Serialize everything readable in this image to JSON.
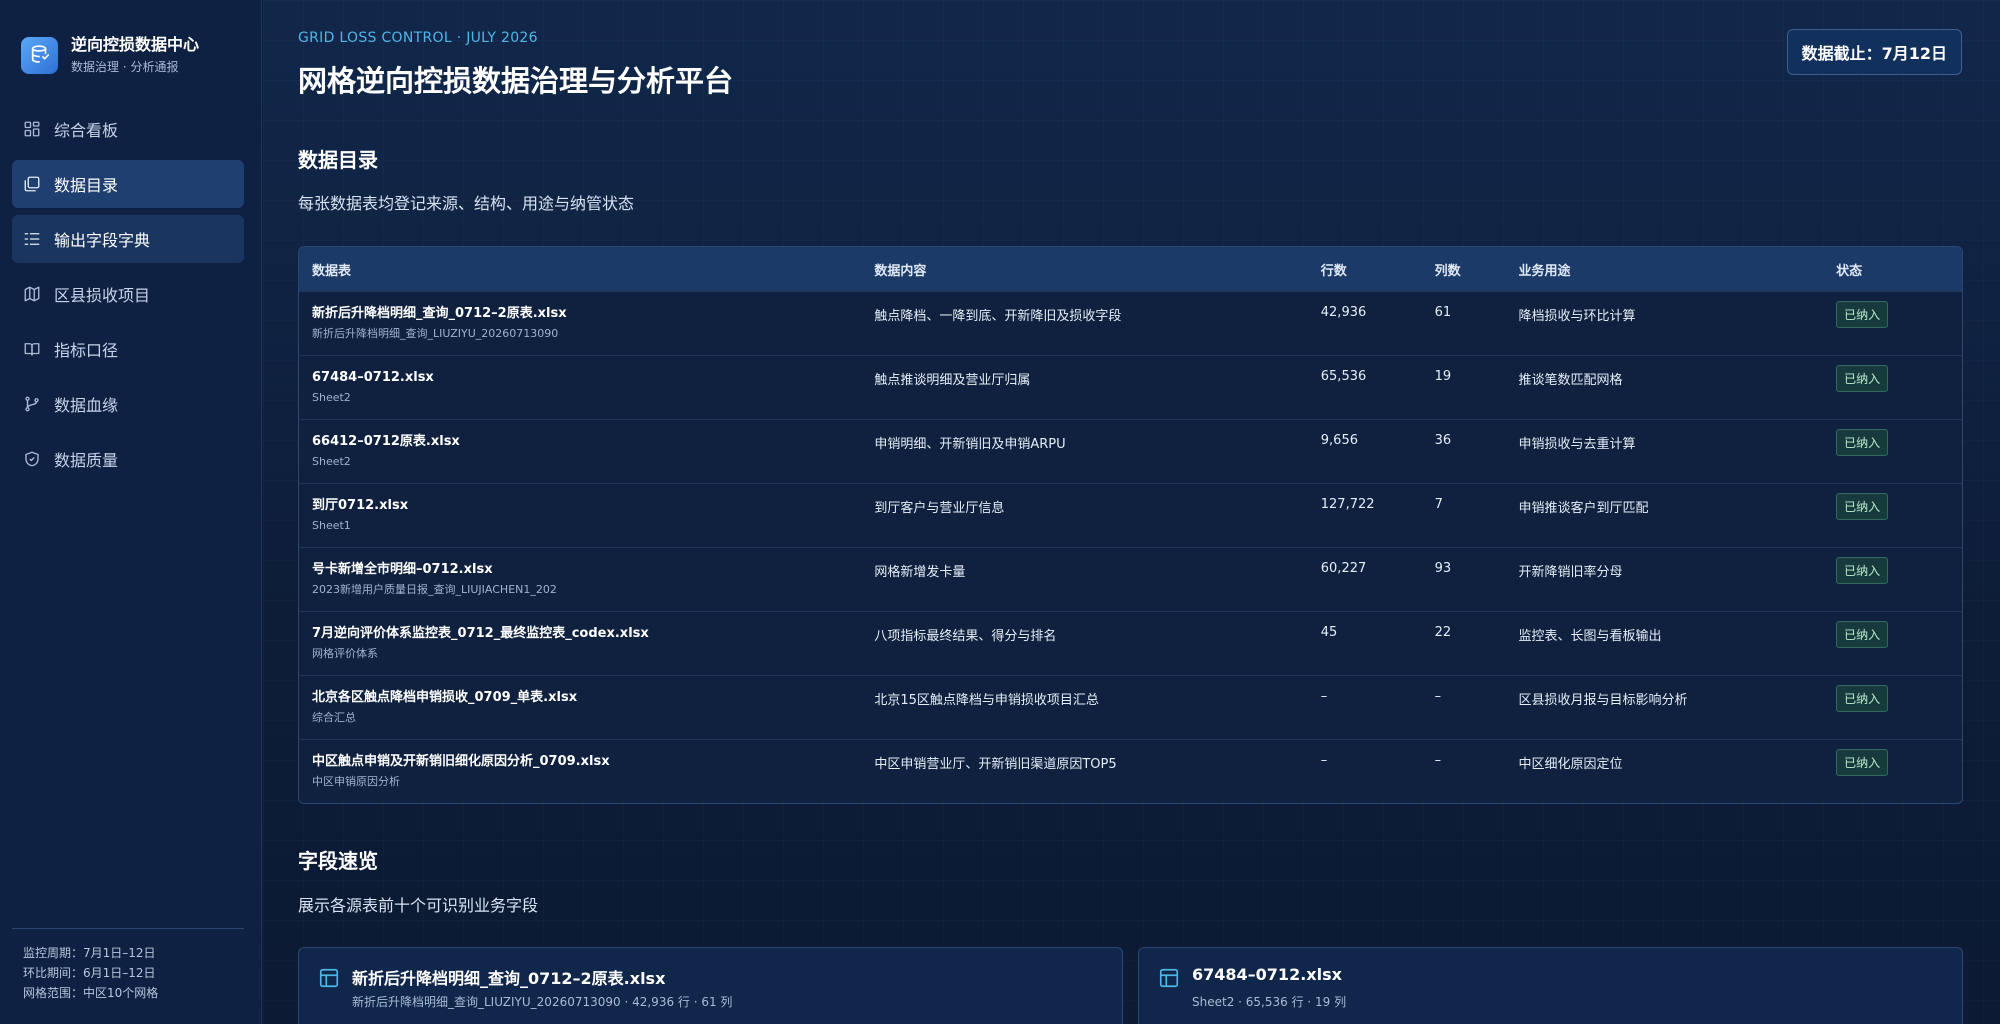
{
  "brand": {
    "title": "逆向控损数据中心",
    "subtitle": "数据治理 · 分析通报"
  },
  "nav": [
    {
      "label": "综合看板",
      "icon": "dashboard-icon",
      "state": "normal"
    },
    {
      "label": "数据目录",
      "icon": "catalog-icon",
      "state": "active"
    },
    {
      "label": "输出字段字典",
      "icon": "list-icon",
      "state": "hover"
    },
    {
      "label": "区县损收项目",
      "icon": "map-icon",
      "state": "normal"
    },
    {
      "label": "指标口径",
      "icon": "book-icon",
      "state": "normal"
    },
    {
      "label": "数据血缘",
      "icon": "lineage-icon",
      "state": "normal"
    },
    {
      "label": "数据质量",
      "icon": "shield-icon",
      "state": "normal"
    }
  ],
  "footer": {
    "period": "监控周期：7月1日–12日",
    "compare": "环比期间：6月1日–12日",
    "scope": "网格范围：中区10个网格"
  },
  "header": {
    "eyebrow": "GRID LOSS CONTROL · JULY 2026",
    "title": "网格逆向控损数据治理与分析平台",
    "date_badge": "数据截止：7月12日"
  },
  "catalog": {
    "title": "数据目录",
    "desc": "每张数据表均登记来源、结构、用途与纳管状态",
    "columns": [
      "数据表",
      "数据内容",
      "行数",
      "列数",
      "业务用途",
      "状态"
    ],
    "rows": [
      {
        "file": "新折后升降档明细_查询_0712–2原表.xlsx",
        "sheet": "新折后升降档明细_查询_LIUZIYU_20260713090",
        "content": "触点降档、一降到底、开新降旧及损收字段",
        "rows": "42,936",
        "cols": "61",
        "usage": "降档损收与环比计算",
        "status": "已纳入"
      },
      {
        "file": "67484–0712.xlsx",
        "sheet": "Sheet2",
        "content": "触点推谈明细及营业厅归属",
        "rows": "65,536",
        "cols": "19",
        "usage": "推谈笔数匹配网格",
        "status": "已纳入"
      },
      {
        "file": "66412–0712原表.xlsx",
        "sheet": "Sheet2",
        "content": "申销明细、开新销旧及申销ARPU",
        "rows": "9,656",
        "cols": "36",
        "usage": "申销损收与去重计算",
        "status": "已纳入"
      },
      {
        "file": "到厅0712.xlsx",
        "sheet": "Sheet1",
        "content": "到厅客户与营业厅信息",
        "rows": "127,722",
        "cols": "7",
        "usage": "申销推谈客户到厅匹配",
        "status": "已纳入"
      },
      {
        "file": "号卡新增全市明细–0712.xlsx",
        "sheet": "2023新增用户质量日报_查询_LIUJIACHEN1_202",
        "content": "网格新增发卡量",
        "rows": "60,227",
        "cols": "93",
        "usage": "开新降销旧率分母",
        "status": "已纳入"
      },
      {
        "file": "7月逆向评价体系监控表_0712_最终监控表_codex.xlsx",
        "sheet": "网格评价体系",
        "content": "八项指标最终结果、得分与排名",
        "rows": "45",
        "cols": "22",
        "usage": "监控表、长图与看板输出",
        "status": "已纳入"
      },
      {
        "file": "北京各区触点降档申销损收_0709_单表.xlsx",
        "sheet": "综合汇总",
        "content": "北京15区触点降档与申销损收项目汇总",
        "rows": "–",
        "cols": "–",
        "usage": "区县损收月报与目标影响分析",
        "status": "已纳入"
      },
      {
        "file": "中区触点申销及开新销旧细化原因分析_0709.xlsx",
        "sheet": "中区申销原因分析",
        "content": "中区申销营业厅、开新销旧渠道原因TOP5",
        "rows": "–",
        "cols": "–",
        "usage": "中区细化原因定位",
        "status": "已纳入"
      }
    ]
  },
  "fields": {
    "title": "字段速览",
    "desc": "展示各源表前十个可识别业务字段",
    "cards": [
      {
        "title": "新折后升降档明细_查询_0712–2原表.xlsx",
        "sub": "新折后升降档明细_查询_LIUZIYU_20260713090 · 42,936 行 · 61 列"
      },
      {
        "title": "67484–0712.xlsx",
        "sub": "Sheet2 · 65,536 行 · 19 列"
      }
    ]
  },
  "colors": {
    "accent": "#4fb6e8",
    "badge_bg": "#173a3c",
    "badge_text": "#bfe9cf"
  }
}
